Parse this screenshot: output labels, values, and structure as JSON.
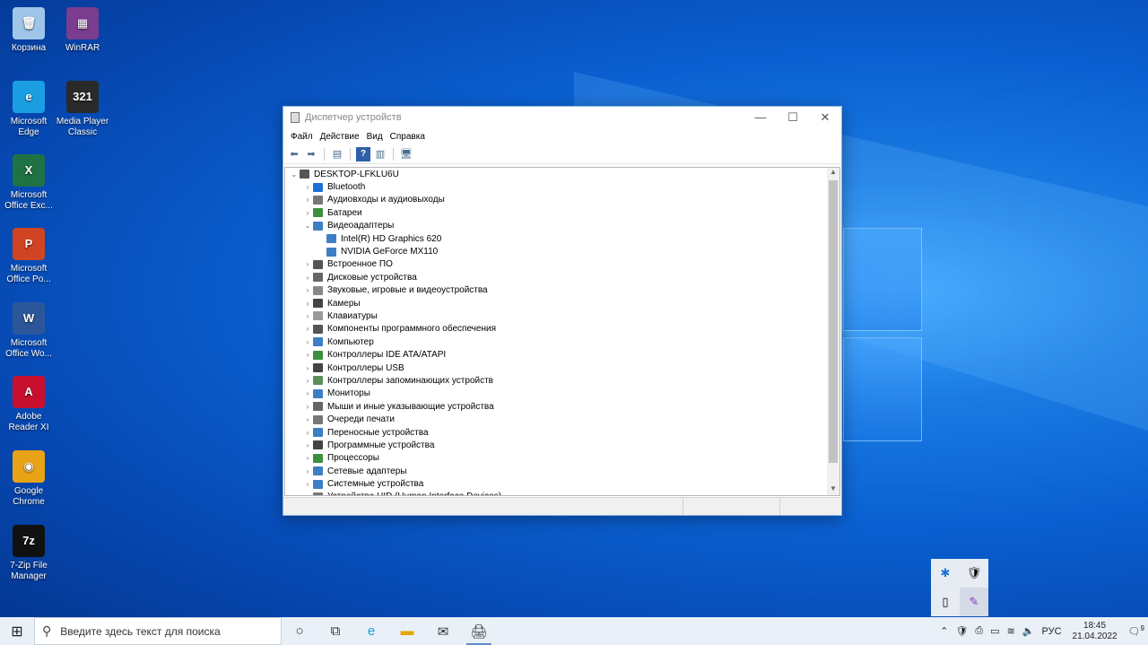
{
  "desktop_icons": [
    {
      "label": "Корзина",
      "icon": "recycle-bin-icon",
      "color": "#9fc6e8",
      "glyph": "🗑"
    },
    {
      "label": "WinRAR",
      "icon": "winrar-icon",
      "color": "#7a3d8f",
      "glyph": "▦"
    },
    {
      "label": "Microsoft Edge",
      "icon": "edge-icon",
      "color": "#1b9de2",
      "glyph": "e"
    },
    {
      "label": "Media Player Classic",
      "icon": "media-player-icon",
      "color": "#2a2a2a",
      "glyph": "321"
    },
    {
      "label": "Microsoft Office Exc...",
      "icon": "excel-icon",
      "color": "#1f7244",
      "glyph": "X"
    },
    {
      "label": "Microsoft Office Po...",
      "icon": "powerpoint-icon",
      "color": "#d04423",
      "glyph": "P"
    },
    {
      "label": "Microsoft Office Wo...",
      "icon": "word-icon",
      "color": "#2b579a",
      "glyph": "W"
    },
    {
      "label": "Adobe Reader XI",
      "icon": "adobe-reader-icon",
      "color": "#c8102e",
      "glyph": "A"
    },
    {
      "label": "Google Chrome",
      "icon": "chrome-icon",
      "color": "#e8a317",
      "glyph": "◉"
    },
    {
      "label": "7-Zip File Manager",
      "icon": "7zip-icon",
      "color": "#111111",
      "glyph": "7z"
    }
  ],
  "window": {
    "title": "Диспетчер устройств",
    "menu": [
      "Файл",
      "Действие",
      "Вид",
      "Справка"
    ],
    "root": "DESKTOP-LFKLU6U",
    "tree": [
      {
        "label": "Bluetooth",
        "level": 1,
        "arrow": "›",
        "icon_color": "#1b6fd6"
      },
      {
        "label": "Аудиовходы и аудиовыходы",
        "level": 1,
        "arrow": "›",
        "icon_color": "#777777"
      },
      {
        "label": "Батареи",
        "level": 1,
        "arrow": "›",
        "icon_color": "#3d8f3d"
      },
      {
        "label": "Видеоадаптеры",
        "level": 1,
        "arrow": "⌄",
        "icon_color": "#3d7fc4"
      },
      {
        "label": "Intel(R) HD Graphics 620",
        "level": 2,
        "arrow": "",
        "icon_color": "#3d7fc4"
      },
      {
        "label": "NVIDIA GeForce MX110",
        "level": 2,
        "arrow": "",
        "icon_color": "#3d7fc4"
      },
      {
        "label": "Встроенное ПО",
        "level": 1,
        "arrow": "›",
        "icon_color": "#555555"
      },
      {
        "label": "Дисковые устройства",
        "level": 1,
        "arrow": "›",
        "icon_color": "#666666"
      },
      {
        "label": "Звуковые, игровые и видеоустройства",
        "level": 1,
        "arrow": "›",
        "icon_color": "#888888"
      },
      {
        "label": "Камеры",
        "level": 1,
        "arrow": "›",
        "icon_color": "#444444"
      },
      {
        "label": "Клавиатуры",
        "level": 1,
        "arrow": "›",
        "icon_color": "#999999"
      },
      {
        "label": "Компоненты программного обеспечения",
        "level": 1,
        "arrow": "›",
        "icon_color": "#555555"
      },
      {
        "label": "Компьютер",
        "level": 1,
        "arrow": "›",
        "icon_color": "#3d7fc4"
      },
      {
        "label": "Контроллеры IDE ATA/ATAPI",
        "level": 1,
        "arrow": "›",
        "icon_color": "#3d8f3d"
      },
      {
        "label": "Контроллеры USB",
        "level": 1,
        "arrow": "›",
        "icon_color": "#444444"
      },
      {
        "label": "Контроллеры запоминающих устройств",
        "level": 1,
        "arrow": "›",
        "icon_color": "#5a8f5a"
      },
      {
        "label": "Мониторы",
        "level": 1,
        "arrow": "›",
        "icon_color": "#3d7fc4"
      },
      {
        "label": "Мыши и иные указывающие устройства",
        "level": 1,
        "arrow": "›",
        "icon_color": "#666666"
      },
      {
        "label": "Очереди печати",
        "level": 1,
        "arrow": "›",
        "icon_color": "#777777"
      },
      {
        "label": "Переносные устройства",
        "level": 1,
        "arrow": "›",
        "icon_color": "#3d7fc4"
      },
      {
        "label": "Программные устройства",
        "level": 1,
        "arrow": "›",
        "icon_color": "#444444"
      },
      {
        "label": "Процессоры",
        "level": 1,
        "arrow": "›",
        "icon_color": "#3d8f3d"
      },
      {
        "label": "Сетевые адаптеры",
        "level": 1,
        "arrow": "›",
        "icon_color": "#3d7fc4"
      },
      {
        "label": "Системные устройства",
        "level": 1,
        "arrow": "›",
        "icon_color": "#3d7fc4"
      },
      {
        "label": "Устройства HID (Human Interface Devices)",
        "level": 1,
        "arrow": "›",
        "icon_color": "#777777"
      }
    ]
  },
  "taskbar": {
    "search_placeholder": "Введите здесь текст для поиска",
    "language": "РУС",
    "time": "18:45",
    "date": "21.04.2022",
    "notification_count": "9"
  }
}
